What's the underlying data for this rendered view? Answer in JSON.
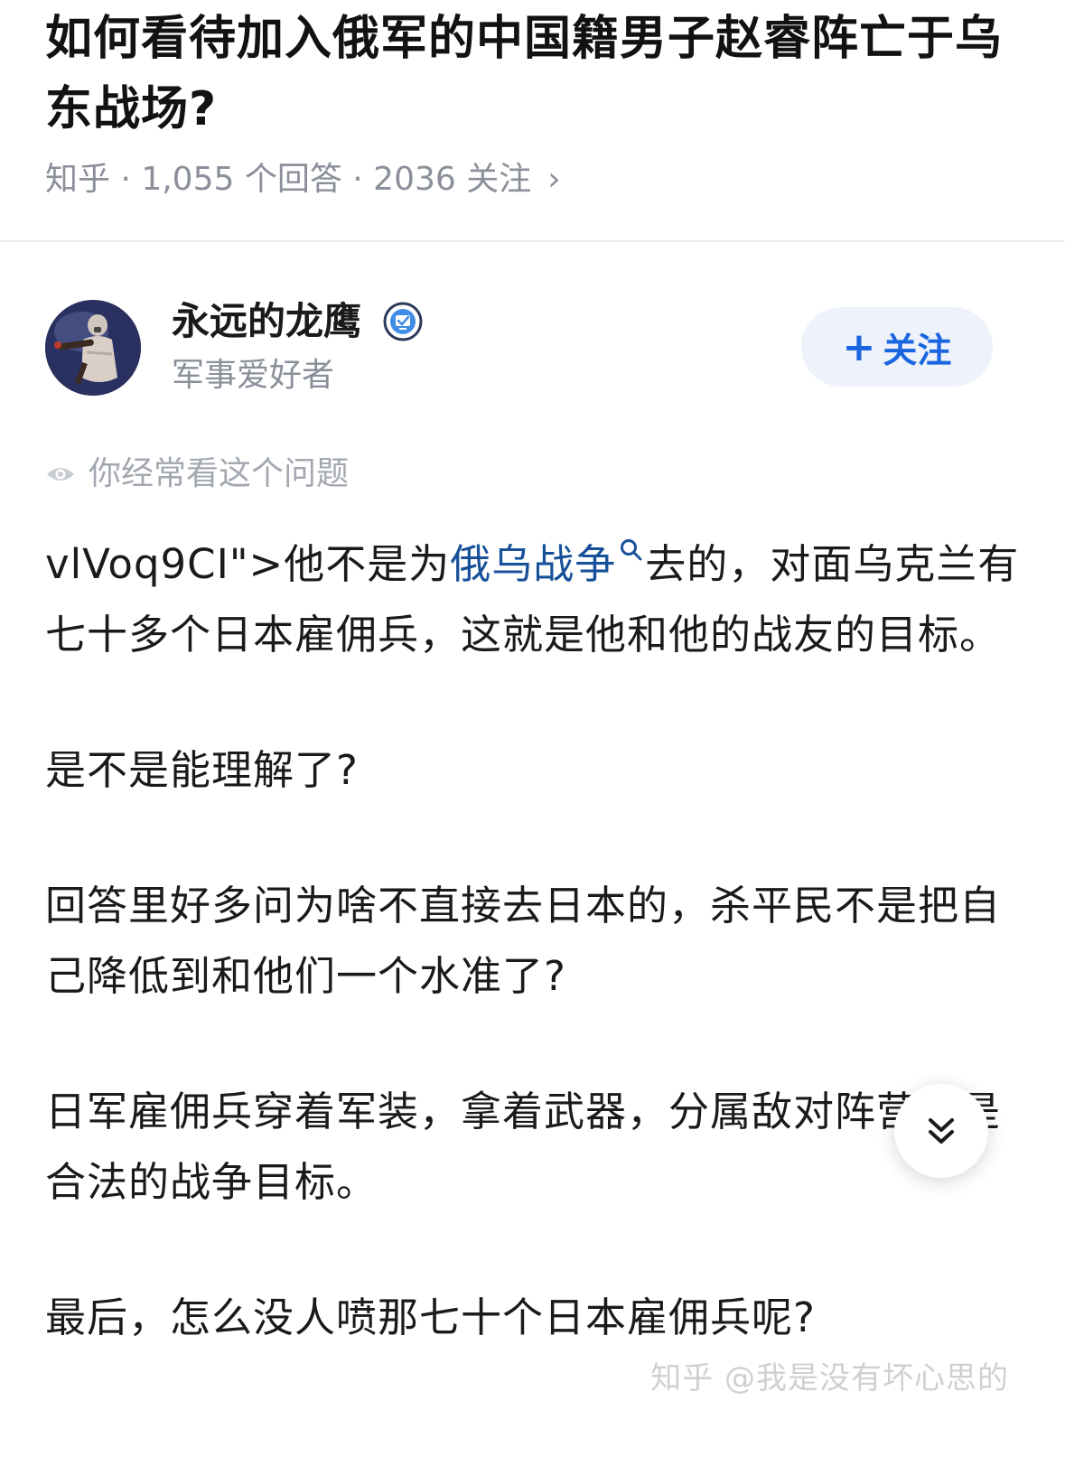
{
  "question": {
    "title": "如何看待加入俄军的中国籍男子赵睿阵亡于乌东战场?",
    "meta": "知乎 · 1,055 个回答 · 2036 关注",
    "chevron": "›"
  },
  "author": {
    "name": "永远的龙鹰",
    "bio": "军事爱好者",
    "follow_label": "关注",
    "follow_plus": "+",
    "verified_icon": "verified-badge-icon"
  },
  "hint": {
    "text": "你经常看这个问题",
    "icon": "eye-icon"
  },
  "answer": {
    "p1_prefix": "vlVoq9CI\">他不是为",
    "p1_link": "俄乌战争",
    "p1_suffix": "去的，对面乌克兰有七十多个日本雇佣兵，这就是他和他的战友的目标。",
    "p2": "是不是能理解了?",
    "p3": "回答里好多问为啥不直接去日本的，杀平民不是把自己降低到和他们一个水准了?",
    "p4": "日军雇佣兵穿着军装，拿着武器，分属敌对阵营。是合法的战争目标。",
    "p5": "最后，怎么没人喷那七十个日本雇佣兵呢?"
  },
  "watermark": "知乎 @我是没有坏心思的",
  "colors": {
    "link": "#175199",
    "follow_bg": "#eef3fb",
    "follow_text": "#1a66e0",
    "meta_text": "#8a8f99"
  }
}
